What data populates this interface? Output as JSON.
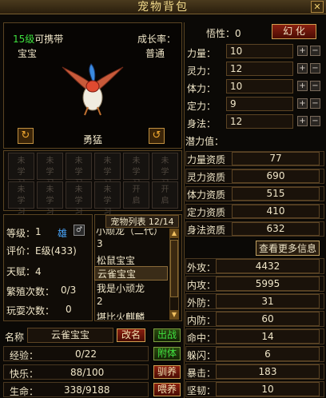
{
  "window": {
    "title": "宠物背包",
    "close": "✕"
  },
  "pet": {
    "level_text": "15级",
    "carry_text": "可携带",
    "name": "宝宝",
    "growth_label": "成长率：",
    "growth_value": "普通",
    "nature": "勇猛"
  },
  "skills": {
    "slots": [
      "未学习",
      "未学习",
      "未学习",
      "未学习",
      "未学习",
      "未学习",
      "未学习",
      "未学习",
      "未学习",
      "未学习",
      "开启",
      "开启"
    ]
  },
  "info": {
    "level_label": "等级：",
    "level_value": "1",
    "gender": "雄",
    "rating_label": "评价：",
    "rating_value": "E级(433)",
    "talent_label": "天赋：",
    "talent_value": "4",
    "breed_label": "繁殖次数：",
    "breed_value": "0/3",
    "play_label": "玩耍次数：",
    "play_value": "0"
  },
  "pet_list": {
    "header_label": "宠物列表",
    "count": "12/14",
    "items": [
      "小顽龙（二代）",
      "3",
      "松鼠宝宝",
      "云雀宝宝",
      "我是小顽龙",
      "2",
      "堪比火麒麟"
    ],
    "selected_index": 3
  },
  "bottom": {
    "name_label": "名称",
    "name_value": "云雀宝宝",
    "rename_btn": "改名",
    "deploy_btn": "出战",
    "exp_label": "经验：",
    "exp_value": "0/22",
    "attach_btn": "附体",
    "happy_label": "快乐：",
    "happy_value": "88/100",
    "tame_btn": "驯养",
    "life_label": "生命：",
    "life_value": "338/9188",
    "feed_btn": "喂养"
  },
  "attrs": {
    "wuxing_label": "悟性：",
    "wuxing_value": "0",
    "huanhua_btn": "幻  化",
    "base": [
      {
        "label": "力量：",
        "value": "10"
      },
      {
        "label": "灵力：",
        "value": "12"
      },
      {
        "label": "体力：",
        "value": "10"
      },
      {
        "label": "定力：",
        "value": "9"
      },
      {
        "label": "身法：",
        "value": "12"
      }
    ],
    "potential_label": "潜力值：",
    "aptitudes": [
      {
        "label": "力量资质",
        "value": "77"
      },
      {
        "label": "灵力资质",
        "value": "690"
      },
      {
        "label": "体力资质",
        "value": "515"
      },
      {
        "label": "定力资质",
        "value": "410"
      },
      {
        "label": "身法资质",
        "value": "632"
      }
    ],
    "more_info_btn": "查看更多信息",
    "combat": [
      {
        "label": "外攻：",
        "value": "4432"
      },
      {
        "label": "内攻：",
        "value": "5995"
      },
      {
        "label": "外防：",
        "value": "31"
      },
      {
        "label": "内防：",
        "value": "60"
      },
      {
        "label": "命中：",
        "value": "14"
      },
      {
        "label": "躲闪：",
        "value": "6"
      },
      {
        "label": "暴击：",
        "value": "183"
      },
      {
        "label": "坚韧：",
        "value": "10"
      }
    ]
  },
  "colors": {
    "level_green": "#3ee03e",
    "gender_blue": "#4aa8ff",
    "gold": "#f0d88a"
  }
}
